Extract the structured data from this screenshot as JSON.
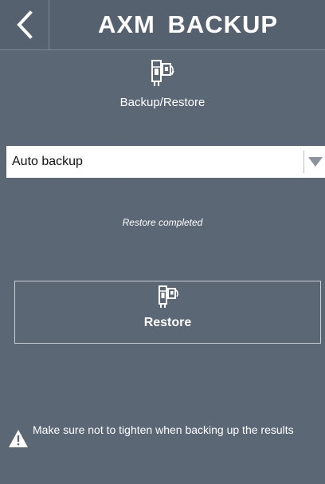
{
  "header": {
    "title": "AXM  BACKUP",
    "back_icon": "chevron-left-icon"
  },
  "hero": {
    "icon": "backup-restore-device-icon",
    "label": "Backup/Restore"
  },
  "mode_select": {
    "selected": "Auto backup",
    "arrow_icon": "triangle-down-icon"
  },
  "status": {
    "text": "Restore completed"
  },
  "restore_button": {
    "icon": "restore-device-icon",
    "label": "Restore"
  },
  "warning": {
    "icon": "warning-triangle-icon",
    "text": "Make sure not to tighten when backing up the results"
  },
  "colors": {
    "background": "#5b6775",
    "header": "#56616f",
    "select_bg": "#ffffff",
    "text": "#ffffff"
  }
}
